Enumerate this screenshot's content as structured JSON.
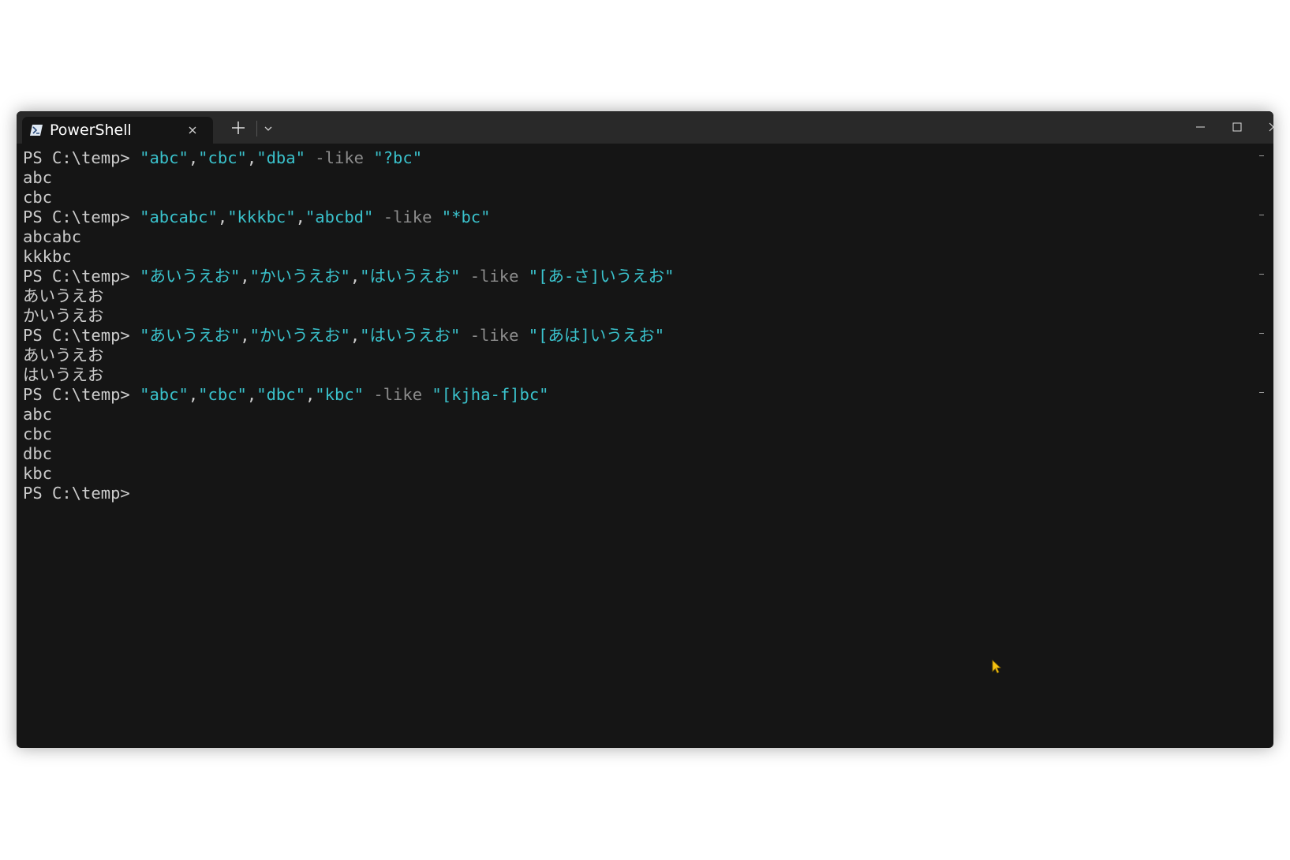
{
  "window": {
    "tab_title": "PowerShell",
    "tab_icon": "powershell-icon",
    "close_tab_icon": "close-icon",
    "new_tab_icon": "plus-icon",
    "dropdown_icon": "chevron-down-icon",
    "minimize_icon": "minimize-icon",
    "maximize_icon": "maximize-icon",
    "close_window_icon": "close-icon"
  },
  "colors": {
    "background": "#151515",
    "titlebar": "#292929",
    "prompt_text": "#cccccc",
    "string_text": "#3ac2cc",
    "operator_text": "#8c8c8c",
    "mouse_pointer": "#f5c211"
  },
  "terminal": {
    "commands": [
      {
        "prompt": "PS C:\\temp> ",
        "args": [
          "\"abc\"",
          "\"cbc\"",
          "\"dba\""
        ],
        "operator": "-like",
        "pattern": "\"?bc\"",
        "output": [
          "abc",
          "cbc"
        ]
      },
      {
        "prompt": "PS C:\\temp> ",
        "args": [
          "\"abcabc\"",
          "\"kkkbc\"",
          "\"abcbd\""
        ],
        "operator": "-like",
        "pattern": "\"*bc\"",
        "output": [
          "abcabc",
          "kkkbc"
        ]
      },
      {
        "prompt": "PS C:\\temp> ",
        "args": [
          "\"あいうえお\"",
          "\"かいうえお\"",
          "\"はいうえお\""
        ],
        "operator": "-like",
        "pattern": "\"[あ-さ]いうえお\"",
        "output": [
          "あいうえお",
          "かいうえお"
        ]
      },
      {
        "prompt": "PS C:\\temp> ",
        "args": [
          "\"あいうえお\"",
          "\"かいうえお\"",
          "\"はいうえお\""
        ],
        "operator": "-like",
        "pattern": "\"[あは]いうえお\"",
        "output": [
          "あいうえお",
          "はいうえお"
        ]
      },
      {
        "prompt": "PS C:\\temp> ",
        "args": [
          "\"abc\"",
          "\"cbc\"",
          "\"dbc\"",
          "\"kbc\""
        ],
        "operator": "-like",
        "pattern": "\"[kjha-f]bc\"",
        "output": [
          "abc",
          "cbc",
          "dbc",
          "kbc"
        ]
      }
    ],
    "final_prompt": "PS C:\\temp>"
  },
  "mouse_pointer_icon": "mouse-pointer-icon"
}
